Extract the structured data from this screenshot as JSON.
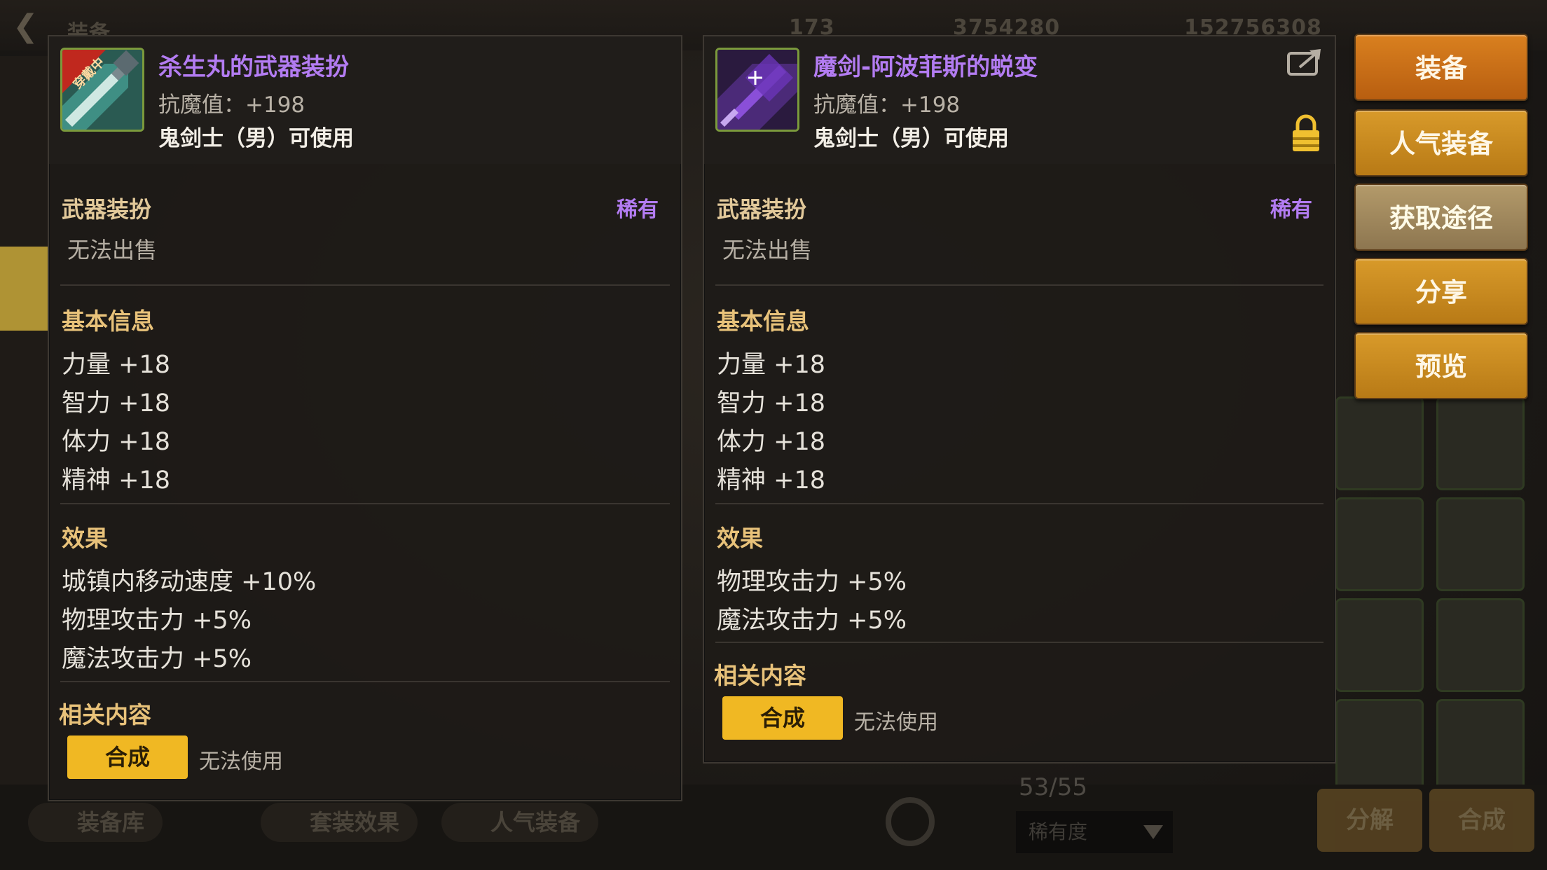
{
  "background": {
    "top_items": [
      "装备",
      "173",
      "3754280",
      "152756308"
    ],
    "bottom_tabs": [
      "装备库",
      "套装效果",
      "人气装备"
    ],
    "inventory_count": "53/55",
    "filter_label": "稀有度",
    "bottom_actions": [
      "分解",
      "合成"
    ]
  },
  "left_item": {
    "badge": "穿戴中",
    "name": "杀生丸的武器装扮",
    "resist": "抗魔值：+198",
    "usable": "鬼剑士（男）可使用",
    "category": "武器装扮",
    "rarity": "稀有",
    "sell_status": "无法出售",
    "basic_title": "基本信息",
    "stats": [
      "力量 +18",
      "智力 +18",
      "体力 +18",
      "精神 +18"
    ],
    "effect_title": "效果",
    "effects": [
      "城镇内移动速度 +10%",
      "物理攻击力 +5%",
      "魔法攻击力 +5%"
    ],
    "related_title": "相关内容",
    "synth_label": "合成",
    "synth_note": "无法使用"
  },
  "right_item": {
    "name": "魔剑-阿波菲斯的蜕变",
    "resist": "抗魔值：+198",
    "usable": "鬼剑士（男）可使用",
    "category": "武器装扮",
    "rarity": "稀有",
    "sell_status": "无法出售",
    "basic_title": "基本信息",
    "stats": [
      "力量 +18",
      "智力 +18",
      "体力 +18",
      "精神 +18"
    ],
    "effect_title": "效果",
    "effects": [
      "物理攻击力 +5%",
      "魔法攻击力 +5%"
    ],
    "related_title": "相关内容",
    "synth_label": "合成",
    "synth_note": "无法使用"
  },
  "actions": [
    "装备",
    "人气装备",
    "获取途径",
    "分享",
    "预览"
  ],
  "colors": {
    "rare_purple": "#b37cf2",
    "section_gold": "#e8c27a",
    "synth_yellow": "#f0b823",
    "action_orange": "#d9801f"
  }
}
